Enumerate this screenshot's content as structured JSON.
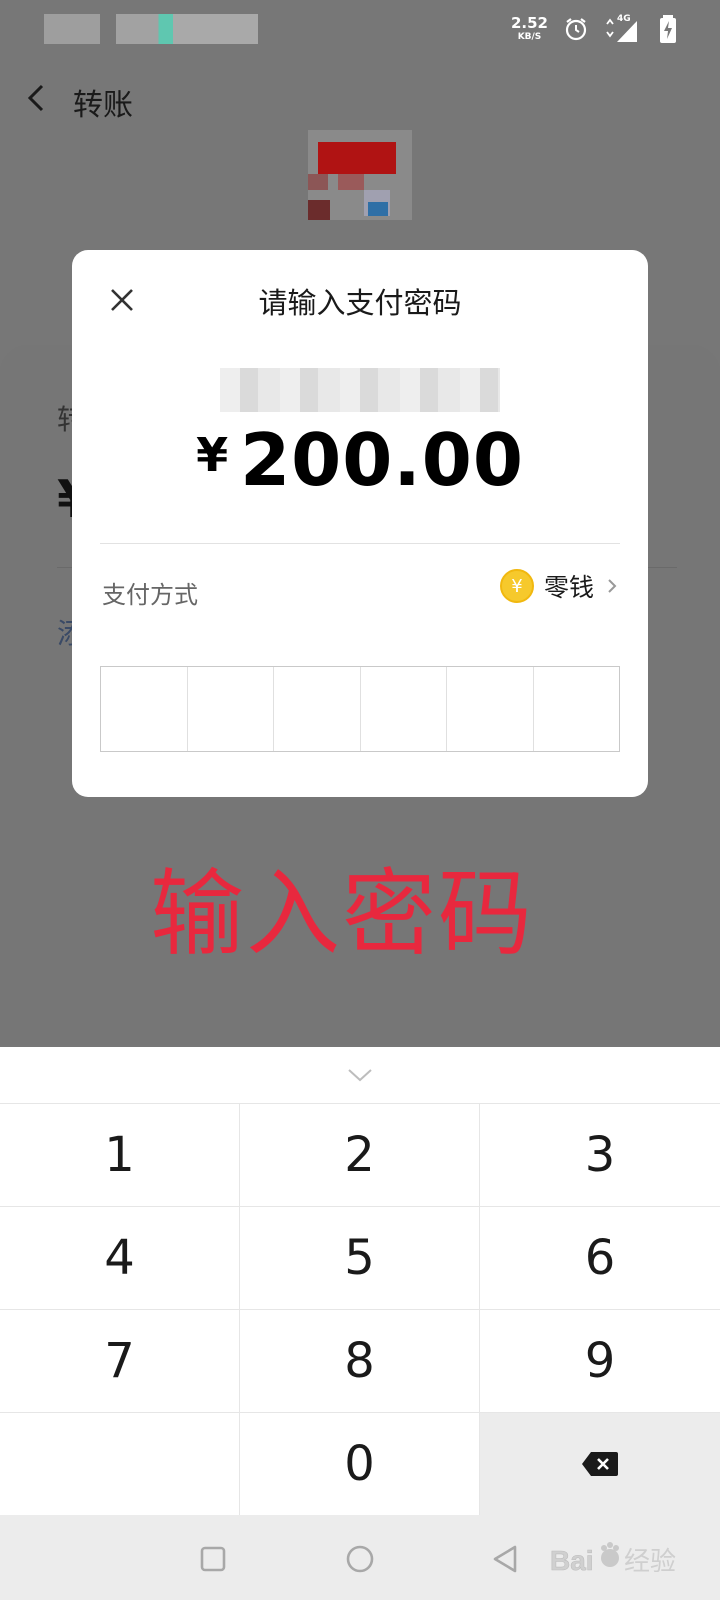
{
  "status_bar": {
    "net_speed": "2.52",
    "net_speed_unit": "KB/S",
    "network_type": "4G"
  },
  "header": {
    "title": "转账"
  },
  "dialog": {
    "title": "请输入支付密码",
    "currency_symbol": "¥",
    "amount": "200.00",
    "payment_method_label": "支付方式",
    "payment_method_value": "零钱",
    "coin_symbol": "¥",
    "password_length": 6
  },
  "annotation": {
    "text": "输入密码",
    "color": "#e8283e"
  },
  "keypad": {
    "keys": [
      "1",
      "2",
      "3",
      "4",
      "5",
      "6",
      "7",
      "8",
      "9",
      "",
      "0",
      "backspace"
    ]
  },
  "colors": {
    "overlay": "#777777",
    "coin": "#f6c92c"
  }
}
